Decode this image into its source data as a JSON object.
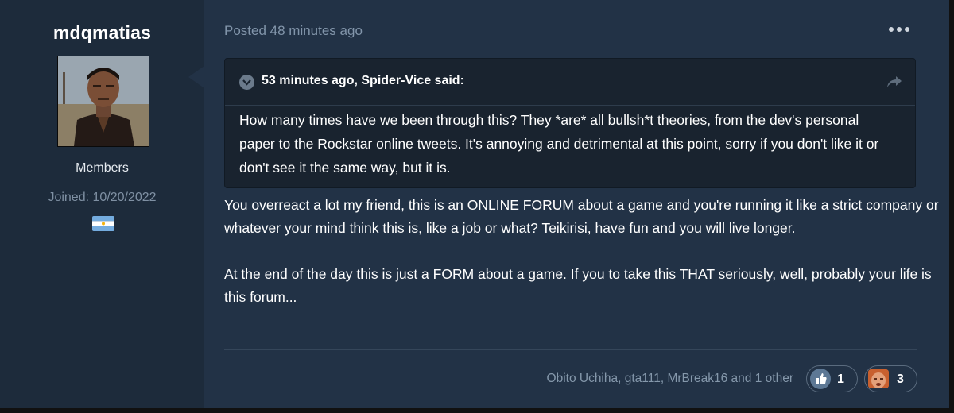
{
  "author": {
    "username": "mdqmatias",
    "group": "Members",
    "joined": "Joined: 10/20/2022",
    "avatar_icon": "gta-character-avatar",
    "flag_icon": "argentina-flag"
  },
  "post": {
    "posted": "Posted 48 minutes ago",
    "menu_icon": "more-options-icon",
    "quote": {
      "citation": "53 minutes ago, Spider-Vice said:",
      "body": "How many times have we been through this? They *are* all bullsh*t theories, from the dev's personal paper to the Rockstar online tweets. It's annoying and detrimental at this point, sorry if you don't like it or don't see it the same way, but it is."
    },
    "paragraphs": [
      "You overreact a lot my friend, this is an ONLINE FORUM about a game and you're running it like a strict company or whatever your mind think this is, like a job or what? Teikirisi, have fun and you will live longer.",
      "At the end of the day this is just a FORM about a game. If you to take this THAT seriously, well, probably your life is this forum..."
    ],
    "reactions": {
      "summary": "Obito Uchiha, gta111, MrBreak16 and 1 other",
      "items": [
        {
          "icon": "thumbs-up-icon",
          "count": "1"
        },
        {
          "icon": "face-reaction-icon",
          "count": "3"
        }
      ]
    }
  },
  "colors": {
    "post_bg": "#223246",
    "author_bg": "#1d2b3b",
    "quote_bg": "#19232f",
    "muted_text": "#8295aa"
  }
}
